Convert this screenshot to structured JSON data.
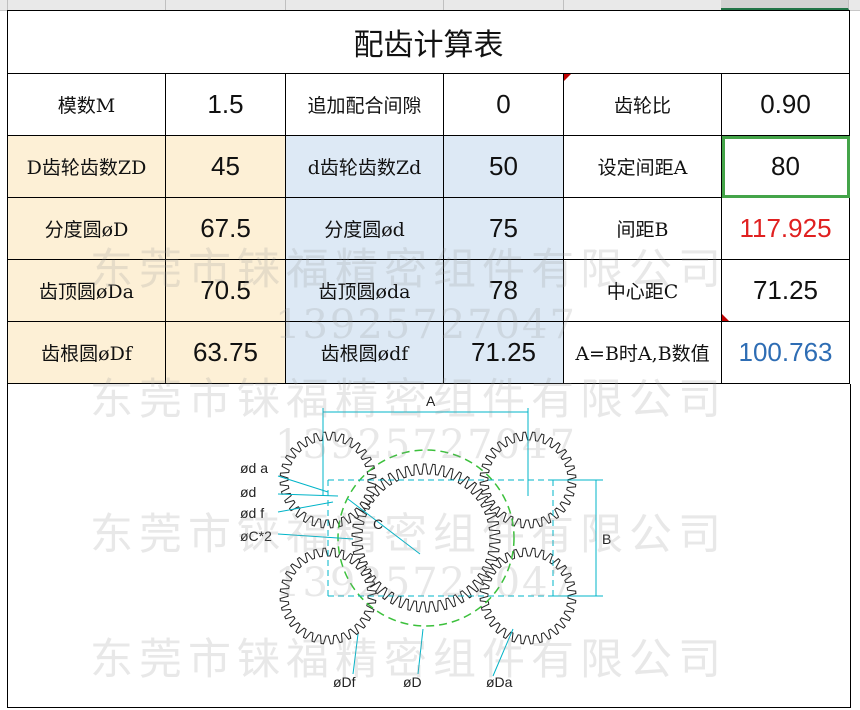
{
  "sheet": {
    "title": "配齿计算表",
    "rows": [
      {
        "c1": {
          "text": "模数M"
        },
        "c2": {
          "text": "1.5"
        },
        "c3": {
          "text": "追加配合间隙"
        },
        "c4": {
          "text": "0"
        },
        "c5": {
          "text": "齿轮比"
        },
        "c6": {
          "text": "0.90"
        }
      },
      {
        "c1": {
          "text": "D齿轮齿数ZD"
        },
        "c2": {
          "text": "45"
        },
        "c3": {
          "text": "d齿轮齿数Zd"
        },
        "c4": {
          "text": "50"
        },
        "c5": {
          "text": "设定间距A"
        },
        "c6": {
          "text": "80"
        }
      },
      {
        "c1": {
          "text": "分度圆øD"
        },
        "c2": {
          "text": "67.5"
        },
        "c3": {
          "text": "分度圆ød"
        },
        "c4": {
          "text": "75"
        },
        "c5": {
          "text": "间距B"
        },
        "c6": {
          "text": "117.925"
        }
      },
      {
        "c1": {
          "text": "齿顶圆øDa"
        },
        "c2": {
          "text": "70.5"
        },
        "c3": {
          "text": "齿顶圆øda"
        },
        "c4": {
          "text": "78"
        },
        "c5": {
          "text": "中心距C"
        },
        "c6": {
          "text": "71.25"
        }
      },
      {
        "c1": {
          "text": "齿根圆øDf"
        },
        "c2": {
          "text": "63.75"
        },
        "c3": {
          "text": "齿根圆ødf"
        },
        "c4": {
          "text": "71.25"
        },
        "c5": {
          "text": "A=B时A,B数值"
        },
        "c6": {
          "text": "100.763"
        }
      }
    ]
  },
  "colors": {
    "label_bg_orange": "#fdf0d6",
    "label_bg_blue": "#dde9f5",
    "value_red": "#e02020",
    "value_blue": "#2e6db4",
    "selection_green": "#44a449",
    "pitch_circle_green": "#3cc03c",
    "dimension_cyan": "#00b4c8"
  },
  "diagram": {
    "labels": {
      "A": "A",
      "B": "B",
      "C": "C",
      "da": "ød a",
      "d": "ød",
      "df": "ød f",
      "c2": "øC*2",
      "Df": "øDf",
      "D": "øD",
      "Da": "øDa"
    }
  },
  "watermark": {
    "company": "东莞市铼福精密组件有限公司",
    "phone": "13925727047"
  }
}
